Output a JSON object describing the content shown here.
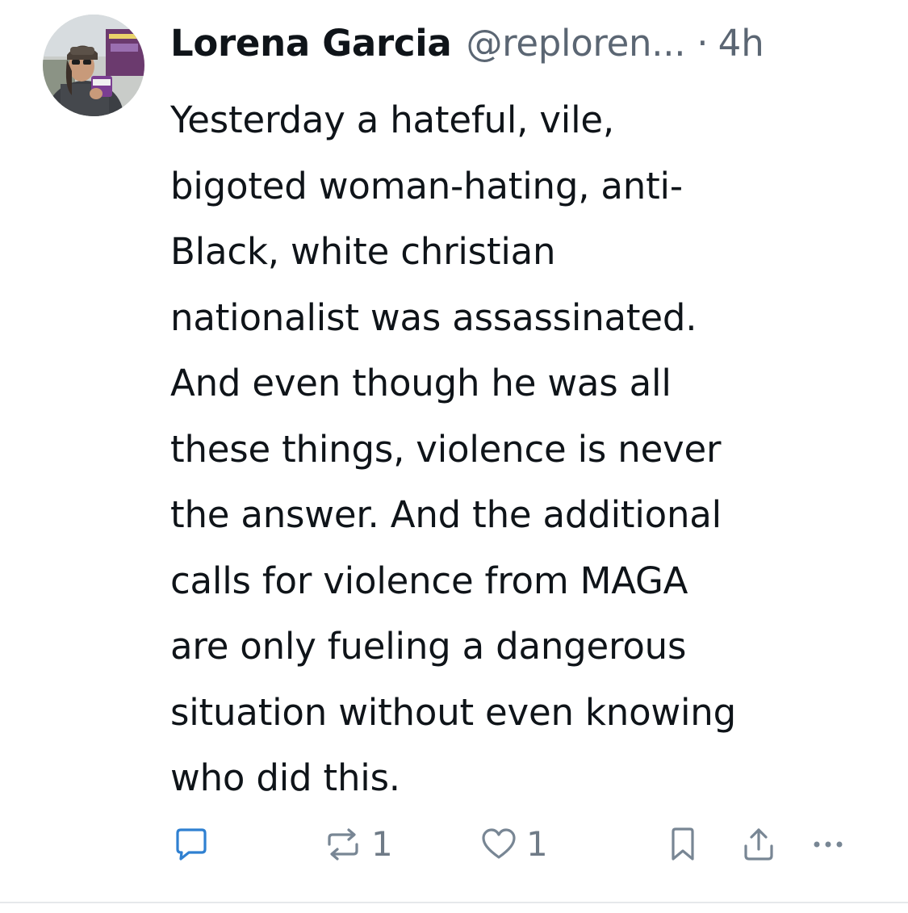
{
  "post": {
    "author_name": "Lorena Garcia",
    "handle": "@reploren...",
    "separator": "·",
    "time": "4h",
    "body_lines": [
      "Yesterday a hateful, vile,",
      "bigoted woman-hating, anti-",
      "Black, white christian",
      "nationalist was assassinated.",
      "And even though he was all",
      "these things, violence is never",
      "the answer. And the additional",
      "calls for violence from MAGA",
      "are only fueling a dangerous",
      "situation without even knowing",
      "who did this."
    ]
  },
  "actions": {
    "reply_icon": "reply-icon",
    "repost_icon": "repost-icon",
    "repost_count": "1",
    "like_icon": "heart-icon",
    "like_count": "1",
    "bookmark_icon": "bookmark-icon",
    "share_icon": "share-icon",
    "more_icon": "more-icon"
  },
  "colors": {
    "text": "#0f1419",
    "secondary_text": "#5b6673",
    "action_icon": "#788694",
    "reply_icon": "#2f80d1",
    "divider": "#e6e8eb"
  }
}
